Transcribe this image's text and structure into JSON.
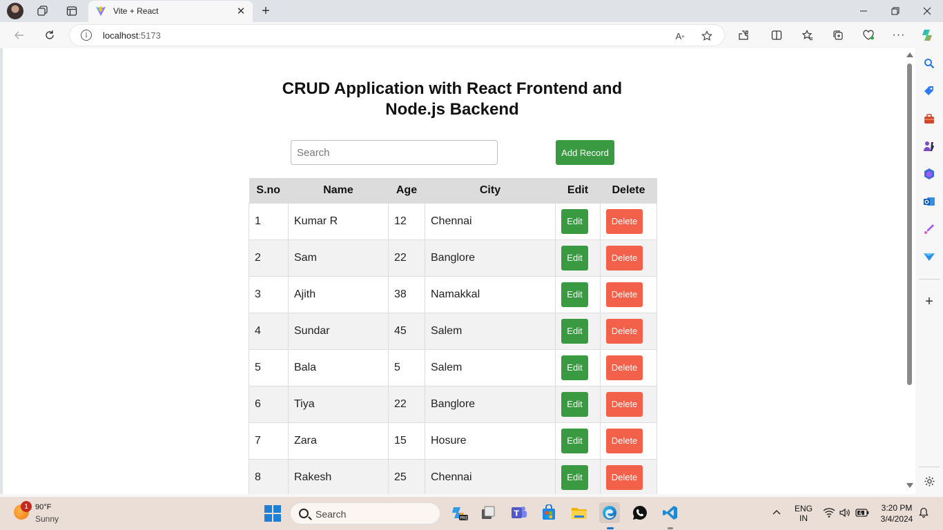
{
  "browser": {
    "tab_title": "Vite + React",
    "url_host": "localhost",
    "url_port": ":5173"
  },
  "page": {
    "title_line1": "CRUD Application with React Frontend and",
    "title_line2": "Node.js Backend",
    "search_placeholder": "Search",
    "search_value": "",
    "add_label": "Add Record",
    "edit_label": "Edit",
    "delete_label": "Delete",
    "columns": [
      "S.no",
      "Name",
      "Age",
      "City",
      "Edit",
      "Delete"
    ],
    "rows": [
      {
        "sno": "1",
        "name": "Kumar R",
        "age": "12",
        "city": "Chennai"
      },
      {
        "sno": "2",
        "name": "Sam",
        "age": "22",
        "city": "Banglore"
      },
      {
        "sno": "3",
        "name": "Ajith",
        "age": "38",
        "city": "Namakkal"
      },
      {
        "sno": "4",
        "name": "Sundar",
        "age": "45",
        "city": "Salem"
      },
      {
        "sno": "5",
        "name": "Bala",
        "age": "5",
        "city": "Salem"
      },
      {
        "sno": "6",
        "name": "Tiya",
        "age": "22",
        "city": "Banglore"
      },
      {
        "sno": "7",
        "name": "Zara",
        "age": "15",
        "city": "Hosure"
      },
      {
        "sno": "8",
        "name": "Rakesh",
        "age": "25",
        "city": "Chennai"
      }
    ]
  },
  "taskbar": {
    "weather_temp": "90°F",
    "weather_cond": "Sunny",
    "weather_badge": "1",
    "search_placeholder": "Search",
    "lang_line1": "ENG",
    "lang_line2": "IN",
    "time": "3:20 PM",
    "date": "3/4/2024"
  },
  "colors": {
    "add_button": "#3a9a41",
    "edit_button": "#3a9a41",
    "delete_button": "#f4614a",
    "header_bg": "#dcdcdc",
    "stripe_bg": "#f2f2f2"
  }
}
